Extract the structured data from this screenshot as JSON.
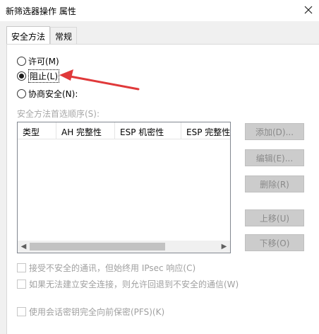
{
  "window": {
    "title": "新筛选器操作 属性"
  },
  "tabs": [
    {
      "label": "安全方法"
    },
    {
      "label": "常规"
    }
  ],
  "radios": [
    {
      "label": "许可(M)",
      "checked": false
    },
    {
      "label": "阻止(L)",
      "checked": true
    },
    {
      "label": "协商安全(N):",
      "checked": false
    }
  ],
  "method_order_label": "安全方法首选顺序(S):",
  "list": {
    "columns": [
      "类型",
      "AH 完整性",
      "ESP 机密性",
      "ESP 完整性"
    ],
    "rows": []
  },
  "buttons": {
    "add": "添加(D)...",
    "edit": "编辑(E)...",
    "remove": "删除(R)",
    "move_up": "上移(U)",
    "move_down": "下移(O)"
  },
  "checkboxes": [
    {
      "label": "接受不安全的通讯，但始终用 IPsec 响应(C)",
      "checked": false
    },
    {
      "label": "如果无法建立安全连接，则允许回退到不安全的通信(W)",
      "checked": false
    },
    {
      "label": "使用会话密钥完全向前保密(PFS)(K)",
      "checked": false
    }
  ],
  "colors": {
    "annotation_arrow": "#e0393a",
    "disabled_text": "#a0a0a0"
  }
}
